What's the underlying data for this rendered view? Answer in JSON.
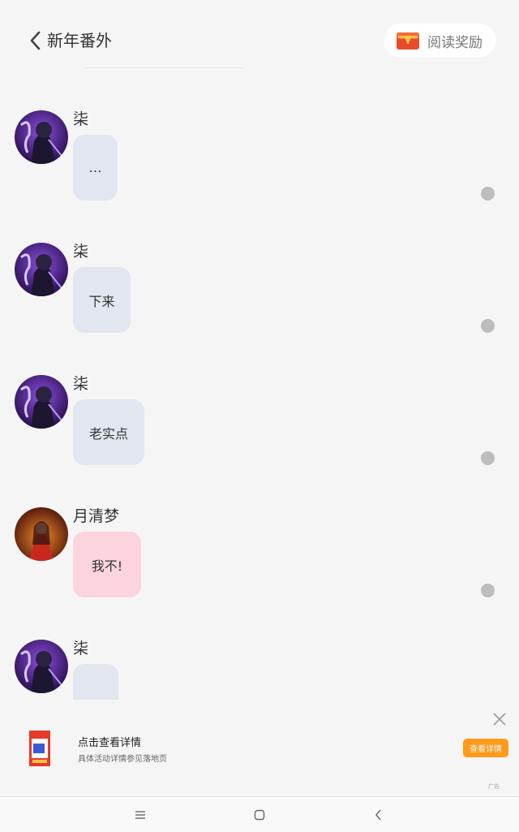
{
  "header": {
    "title": "新年番外",
    "reward_label": "阅读奖励"
  },
  "messages": [
    {
      "sender": "柒",
      "text": "…",
      "avatar": "dark-knight-avatar"
    },
    {
      "sender": "柒",
      "text": "下来",
      "avatar": "dark-knight-avatar"
    },
    {
      "sender": "柒",
      "text": "老实点",
      "avatar": "dark-knight-avatar"
    },
    {
      "sender": "月清梦",
      "text": "我不!",
      "avatar": "red-dress-girl-avatar"
    },
    {
      "sender": "柒",
      "text": "",
      "avatar": "dark-knight-avatar"
    }
  ],
  "ad": {
    "title": "点击查看详情",
    "subtitle": "具体活动详情参见落地页",
    "button_label": "查看详情",
    "tag": "广告"
  },
  "colors": {
    "background": "#f5f5f5",
    "bubble_default": "#e1e6ef",
    "bubble_pink": "#fcd4dd",
    "ad_button": "#ff9a1a"
  },
  "icons": [
    "back-icon",
    "gift-box-icon",
    "close-icon",
    "menu-icon",
    "home-icon",
    "nav-back-icon"
  ]
}
